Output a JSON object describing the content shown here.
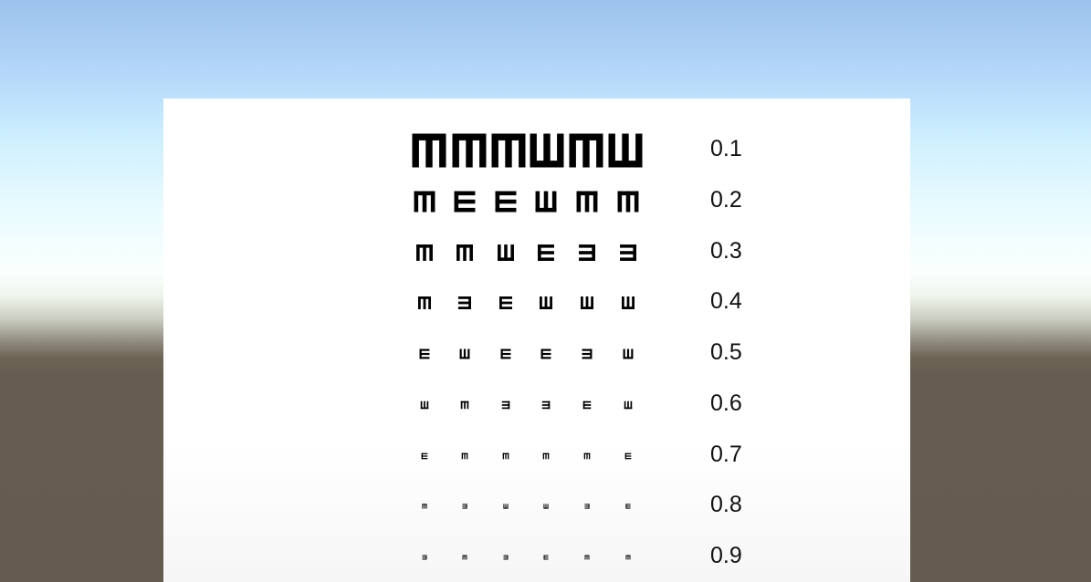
{
  "scene": {
    "sky_top_color": "#9cc2ec",
    "horizon_color": "#fbfffe",
    "ground_color": "#655b4f"
  },
  "eye_chart": {
    "board_color": "#ffffff",
    "optotype_color": "#000000",
    "rows": [
      {
        "acuity": "0.1",
        "optotypes": [
          "down",
          "down",
          "down",
          "up",
          "down",
          "up"
        ]
      },
      {
        "acuity": "0.2",
        "optotypes": [
          "down",
          "right",
          "right",
          "up",
          "down",
          "down"
        ]
      },
      {
        "acuity": "0.3",
        "optotypes": [
          "down",
          "down",
          "up",
          "right",
          "left",
          "left"
        ]
      },
      {
        "acuity": "0.4",
        "optotypes": [
          "down",
          "left",
          "right",
          "up",
          "up",
          "up"
        ]
      },
      {
        "acuity": "0.5",
        "optotypes": [
          "right",
          "up",
          "right",
          "right",
          "left",
          "up"
        ]
      },
      {
        "acuity": "0.6",
        "optotypes": [
          "up",
          "down",
          "left",
          "left",
          "right",
          "up"
        ]
      },
      {
        "acuity": "0.7",
        "optotypes": [
          "right",
          "down",
          "down",
          "down",
          "down",
          "right"
        ]
      },
      {
        "acuity": "0.8",
        "optotypes": [
          "down",
          "left",
          "up",
          "up",
          "left",
          "right"
        ]
      },
      {
        "acuity": "0.9",
        "optotypes": [
          "left",
          "down",
          "left",
          "right",
          "down",
          "down"
        ]
      }
    ]
  }
}
